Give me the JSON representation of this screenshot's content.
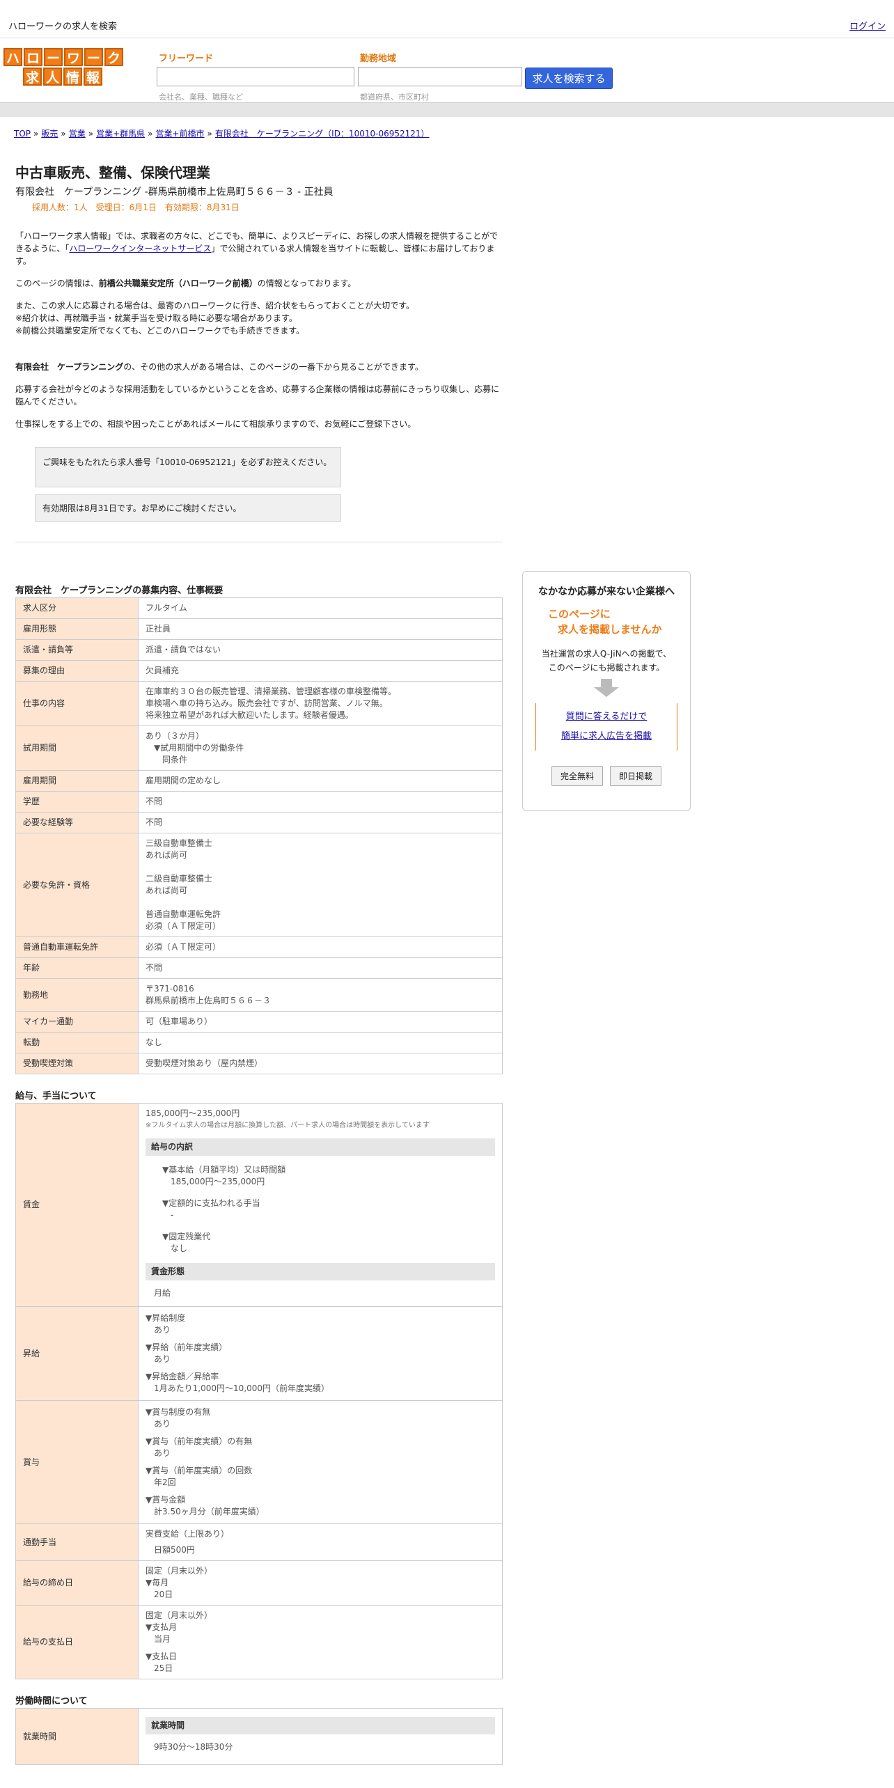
{
  "topbar": {
    "site_title": "ハローワークの求人を検索",
    "login": "ログイン"
  },
  "logo": {
    "row1": [
      "ハ",
      "ロ",
      "ー",
      "ワ",
      "ー",
      "ク"
    ],
    "row2": [
      "求",
      "人",
      "情",
      "報"
    ]
  },
  "search": {
    "keyword_label": "フリーワード",
    "keyword_hint": "会社名、業種、職種など",
    "area_label": "勤務地域",
    "area_hint": "都道府県、市区町村",
    "button": "求人を検索する"
  },
  "breadcrumb": [
    "TOP",
    "販売",
    "営業",
    "営業+群馬県",
    "営業+前橋市",
    "有限会社　ケープランニング（ID：10010-06952121）"
  ],
  "job": {
    "title": "中古車販売、整備、保険代理業",
    "company_line": "有限会社　ケープランニング -群馬県前橋市上佐鳥町５６６－３ - 正社員",
    "meta": "採用人数：1人　受理日：6月1日　有効期限：8月31日"
  },
  "intro": {
    "p1_a": "「ハローワーク求人情報」では、求職者の方々に、どこでも、簡単に、よりスピーディに、お探しの求人情報を提供することができるように、「",
    "p1_link": "ハローワークインターネットサービス",
    "p1_b": "」で公開されている求人情報を当サイトに転載し、皆様にお届けしております。",
    "p2_a": "このページの情報は、",
    "p2_bold": "前橋公共職業安定所（ハローワーク前橋）",
    "p2_b": "の情報となっております。",
    "p3_1": "また、この求人に応募される場合は、最寄のハローワークに行き、紹介状をもらっておくことが大切です。",
    "p3_2": "※紹介状は、再就職手当・就業手当を受け取る時に必要な場合があります。",
    "p3_3": "※前橋公共職業安定所でなくても、どこのハローワークでも手続きできます。",
    "p4_bold": "有限会社　ケープランニング",
    "p4_b": "の、その他の求人がある場合は、このページの一番下から見ることができます。",
    "p5": "応募する会社が今どのような採用活動をしているかということを含め、応募する企業様の情報は応募前にきっちり収集し、応募に臨んでください。",
    "p6": "仕事探しをする上での、相談や困ったことがあればメールにて相談承りますので、お気軽にご登録下さい。",
    "note1": "ご興味をもたれたら求人番号「10010-06952121」を必ずお控えください。",
    "note2": "有効期限は8月31日です。お早めにご検討ください。"
  },
  "overview": {
    "title": "有限会社　ケープランニングの募集内容、仕事概要",
    "rows": [
      {
        "label": "求人区分",
        "lines": [
          "フルタイム"
        ]
      },
      {
        "label": "雇用形態",
        "lines": [
          "正社員"
        ]
      },
      {
        "label": "派遣・請負等",
        "lines": [
          "派遣・請負ではない"
        ]
      },
      {
        "label": "募集の理由",
        "lines": [
          "欠員補充"
        ]
      },
      {
        "label": "仕事の内容",
        "lines": [
          "在庫車約３０台の販売管理、清掃業務、管理顧客様の車検整備等。",
          "車検場へ車の持ち込み。販売会社ですが、訪問営業、ノルマ無。",
          "将来独立希望があれば大歓迎いたします。経験者優遇。"
        ]
      },
      {
        "label": "試用期間",
        "lines": [
          "あり（３か月）",
          "　▼試用期間中の労働条件",
          "　　同条件"
        ]
      },
      {
        "label": "雇用期間",
        "lines": [
          "雇用期間の定めなし"
        ]
      },
      {
        "label": "学歴",
        "lines": [
          "不問"
        ]
      },
      {
        "label": "必要な経験等",
        "lines": [
          "不問"
        ]
      },
      {
        "label": "必要な免許・資格",
        "lines": [
          "三級自動車整備士",
          "あれば尚可",
          "",
          "二級自動車整備士",
          "あれば尚可",
          "",
          "普通自動車運転免許",
          "必須（ＡＴ限定可）"
        ]
      },
      {
        "label": "普通自動車運転免許",
        "lines": [
          "必須（ＡＴ限定可）"
        ]
      },
      {
        "label": "年齢",
        "lines": [
          "不問"
        ]
      },
      {
        "label": "勤務地",
        "lines": [
          "〒371-0816",
          "群馬県前橋市上佐鳥町５６６－３"
        ]
      },
      {
        "label": "マイカー通勤",
        "lines": [
          "可（駐車場あり）"
        ]
      },
      {
        "label": "転勤",
        "lines": [
          "なし"
        ]
      },
      {
        "label": "受動喫煙対策",
        "lines": [
          "受動喫煙対策あり（屋内禁煙）"
        ]
      }
    ]
  },
  "salary": {
    "title": "給与、手当について",
    "wage_label": "賃金",
    "wage_range": "185,000円〜235,000円",
    "wage_note": "※フルタイム求人の場合は月額に換算した額、パート求人の場合は時間額を表示しています",
    "breakdown_head": "給与の内訳",
    "b1_head": "▼基本給（月額平均）又は時間額",
    "b1_val": "185,000円〜235,000円",
    "b2_head": "▼定額的に支払われる手当",
    "b2_val": "-",
    "b3_head": "▼固定残業代",
    "b3_val": "なし",
    "form_head": "賃金形態",
    "form_val": "月給",
    "raise_label": "昇給",
    "raise": [
      {
        "head": "▼昇給制度",
        "val": "あり"
      },
      {
        "head": "▼昇給（前年度実績）",
        "val": "あり"
      },
      {
        "head": "▼昇給金額／昇給率",
        "val": "1月あたり1,000円〜10,000円（前年度実績）"
      }
    ],
    "bonus_label": "賞与",
    "bonus": [
      {
        "head": "▼賞与制度の有無",
        "val": "あり"
      },
      {
        "head": "▼賞与（前年度実績）の有無",
        "val": "あり"
      },
      {
        "head": "▼賞与（前年度実績）の回数",
        "val": "年2回"
      },
      {
        "head": "▼賞与金額",
        "val": "計3.50ヶ月分（前年度実績）"
      }
    ],
    "commute_label": "通勤手当",
    "commute_1": "実費支給（上限あり）",
    "commute_2": "日額500円",
    "cutoff_label": "給与の締め日",
    "cutoff_1": "固定（月末以外）",
    "cutoff_2": "▼毎月",
    "cutoff_3": "20日",
    "pay_label": "給与の支払日",
    "pay_1": "固定（月末以外）",
    "pay_2": "▼支払月",
    "pay_3": "当月",
    "pay_4": "▼支払日",
    "pay_5": "25日"
  },
  "work": {
    "title": "労働時間について",
    "hours_label": "就業時間",
    "hours_head": "就業時間",
    "hours_val": "9時30分〜18時30分"
  },
  "sidebar": {
    "title": "なかなか応募が来ない企業様へ",
    "catch1": "このページに",
    "catch2": "求人を掲載しませんか",
    "desc1": "当社運営の求人Q-JiNへの掲載で、",
    "desc2": "このページにも掲載されます。",
    "link1": "質問に答えるだけで",
    "link2": "簡単に求人広告を掲載",
    "btn1": "完全無料",
    "btn2": "即日掲載"
  }
}
